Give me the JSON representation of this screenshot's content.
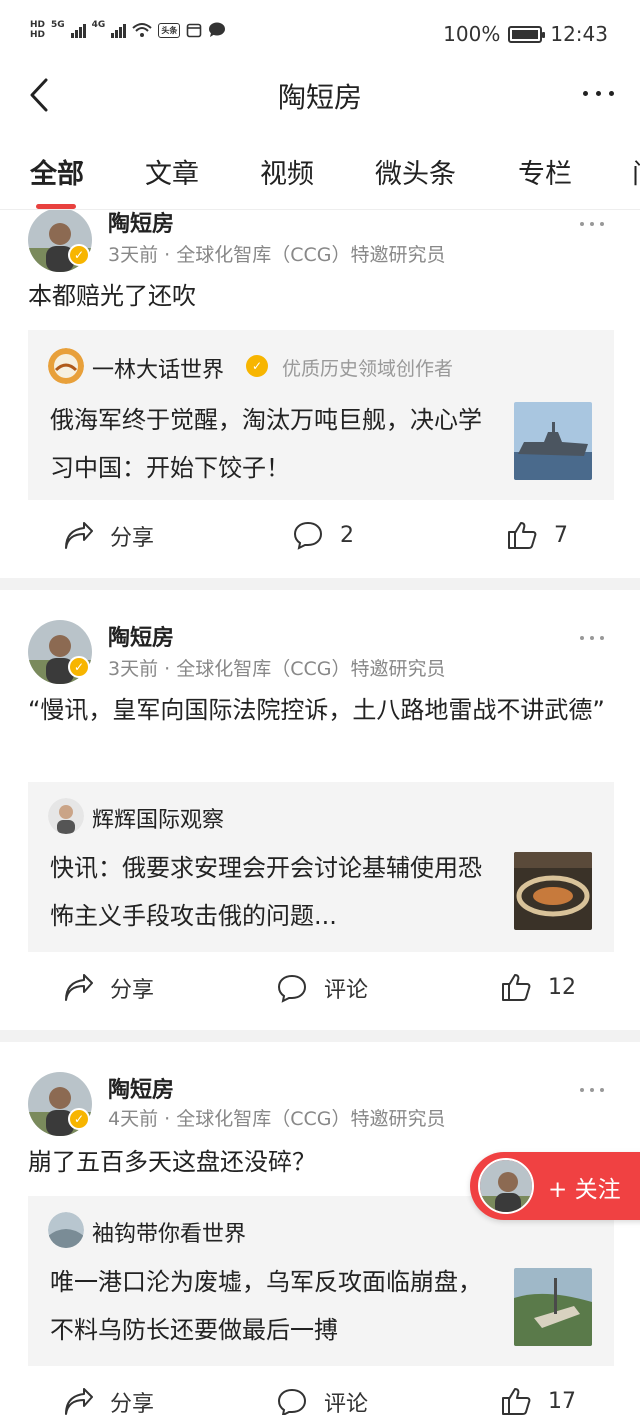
{
  "status_bar": {
    "sim_labels": [
      "HD",
      "HD"
    ],
    "network1": "5G",
    "network2": "4G",
    "app_badge": "头条",
    "battery_percent": "100%",
    "battery_level": 1.0,
    "time": "12:43"
  },
  "header": {
    "title": "陶短房"
  },
  "tabs": [
    {
      "label": "全部",
      "active": true
    },
    {
      "label": "文章",
      "active": false
    },
    {
      "label": "视频",
      "active": false
    },
    {
      "label": "微头条",
      "active": false
    },
    {
      "label": "专栏",
      "active": false
    },
    {
      "label": "问",
      "active": false
    }
  ],
  "posts": [
    {
      "author": "陶短房",
      "meta": "3天前 · 全球化智库（CCG）特邀研究员",
      "text": "本都赔光了还吹",
      "card": {
        "author": "一林大话世界",
        "tag": "优质历史领域创作者",
        "verified": true,
        "text": "俄海军终于觉醒，淘汰万吨巨舰，决心学习中国：开始下饺子！"
      },
      "share_label": "分享",
      "comment_label": "2",
      "like_count": "7"
    },
    {
      "author": "陶短房",
      "meta": "3天前 · 全球化智库（CCG）特邀研究员",
      "text": "“慢讯，皇军向国际法院控诉，土八路地雷战不讲武德”",
      "card": {
        "author": "辉辉国际观察",
        "tag": "",
        "verified": false,
        "text": "快讯：俄要求安理会开会讨论基辅使用恐怖主义手段攻击俄的问题..."
      },
      "share_label": "分享",
      "comment_label": "评论",
      "like_count": "12"
    },
    {
      "author": "陶短房",
      "meta": "4天前 · 全球化智库（CCG）特邀研究员",
      "text": "崩了五百多天这盘还没碎？",
      "card": {
        "author": "袖钩带你看世界",
        "tag": "",
        "verified": false,
        "text": "唯一港口沦为废墟，乌军反攻面临崩盘，不料乌防长还要做最后一搏"
      },
      "share_label": "分享",
      "comment_label": "评论",
      "like_count": "17"
    }
  ],
  "follow_button": {
    "label": "+ 关注"
  },
  "colors": {
    "accent": "#e8413e",
    "verify": "#f7b500",
    "card_bg": "#f4f4f4"
  }
}
